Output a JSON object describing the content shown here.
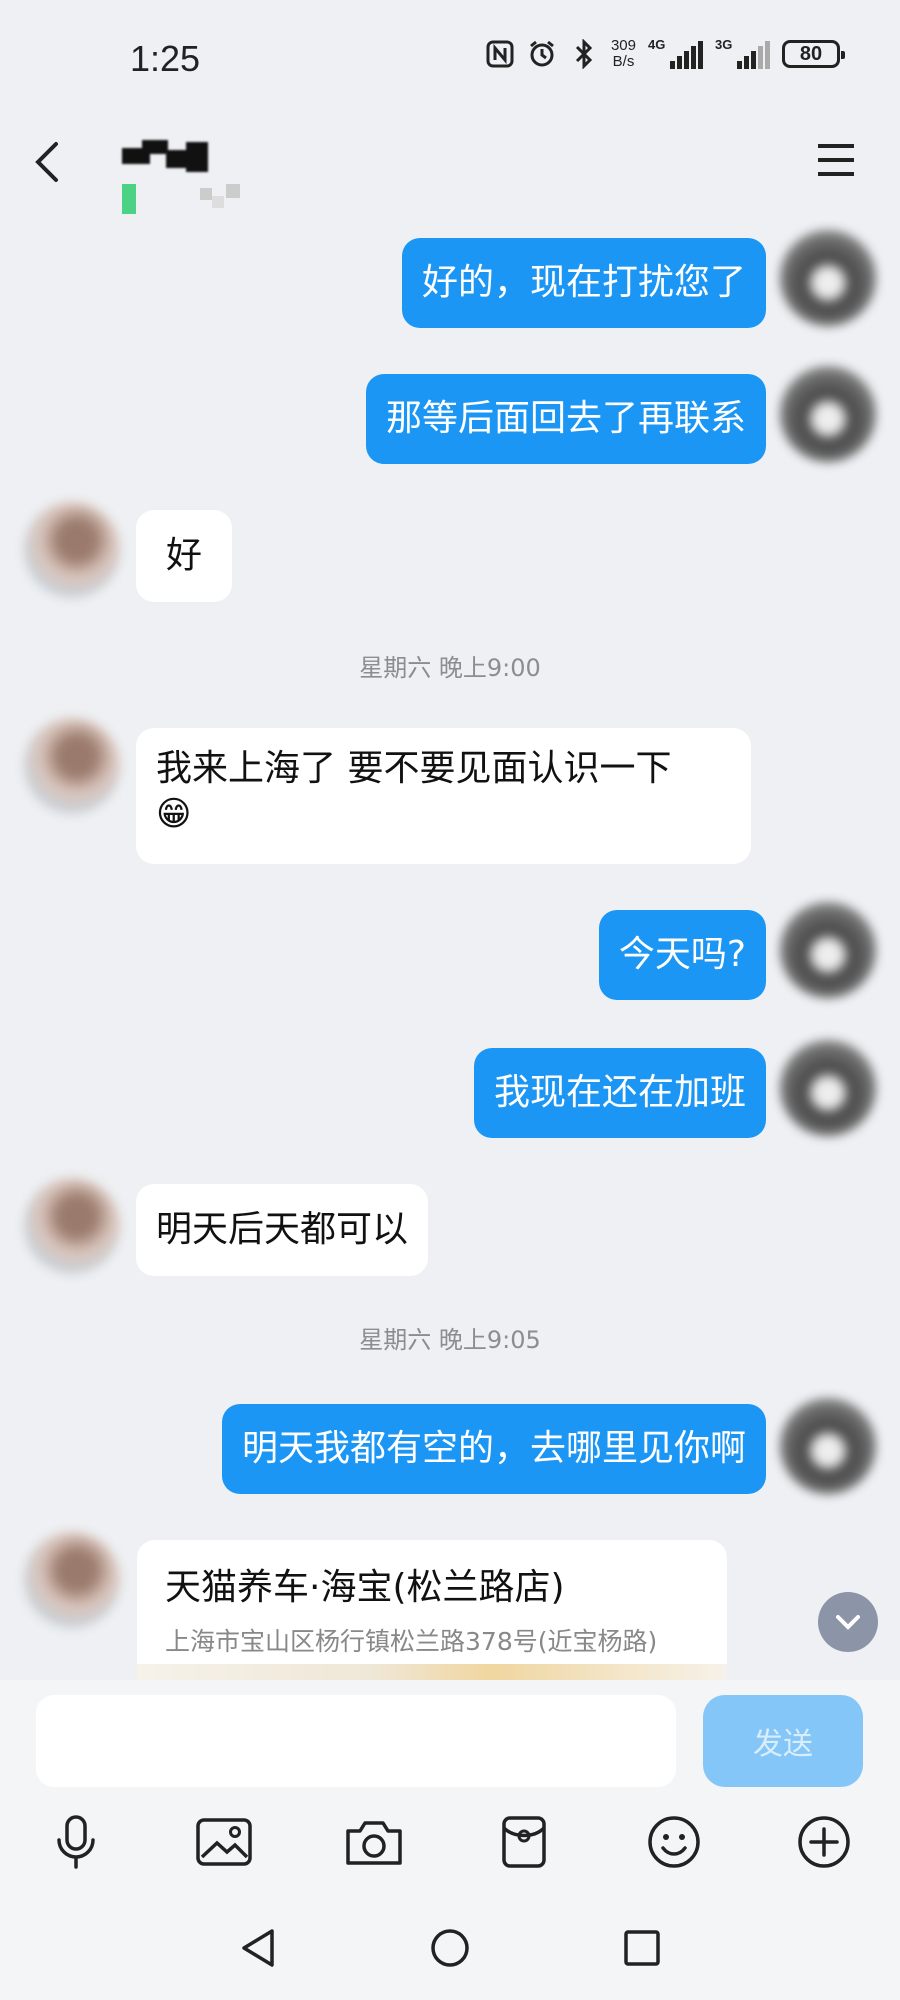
{
  "status_bar": {
    "time": "1:25",
    "net_speed_value": "309",
    "net_speed_unit": "B/s",
    "signal1_label": "4G",
    "signal2_label": "3G",
    "battery": "80",
    "icons": [
      "nfc-icon",
      "alarm-icon",
      "bluetooth-icon"
    ]
  },
  "chat": {
    "timestamps": [
      "星期六 晚上9:00",
      "星期六 晚上9:05"
    ],
    "messages": [
      {
        "side": "self",
        "text": "好的，现在打扰您了"
      },
      {
        "side": "self",
        "text": "那等后面回去了再联系"
      },
      {
        "side": "other",
        "text": "好"
      },
      {
        "side": "other",
        "text": "我来上海了 要不要见面认识一下",
        "emoji": "😁"
      },
      {
        "side": "self",
        "text": "今天吗?"
      },
      {
        "side": "self",
        "text": "我现在还在加班"
      },
      {
        "side": "other",
        "text": "明天后天都可以"
      },
      {
        "side": "self",
        "text": "明天我都有空的，去哪里见你啊"
      }
    ],
    "location_card": {
      "title": "天猫养车·海宝(松兰路店)",
      "address": "上海市宝山区杨行镇松兰路378号(近宝杨路)"
    }
  },
  "input": {
    "value": "",
    "send_label": "发送"
  },
  "toolbar": [
    "microphone-icon",
    "image-icon",
    "camera-icon",
    "red-packet-icon",
    "emoji-icon",
    "plus-icon"
  ],
  "colors": {
    "self_bubble": "#1c96f4",
    "background": "#eef0f3",
    "send_disabled": "#84c6f7"
  }
}
